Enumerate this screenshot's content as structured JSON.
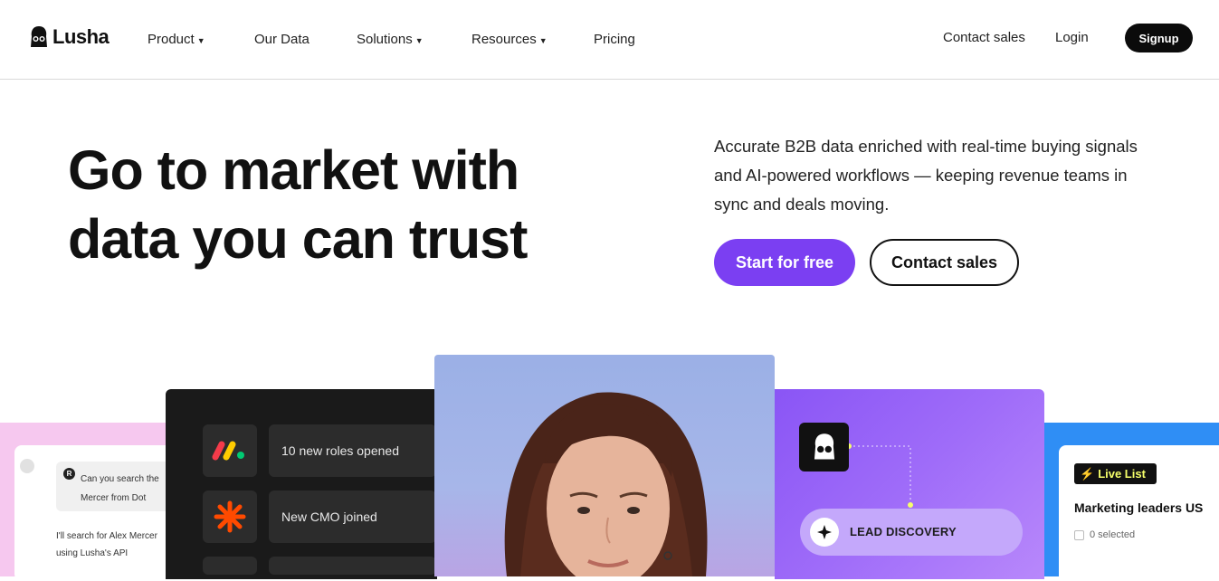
{
  "brand": {
    "name": "Lusha",
    "logo_icon": "lusha-logo-icon"
  },
  "nav": {
    "items": [
      {
        "label": "Product",
        "dropdown": true
      },
      {
        "label": "Our Data",
        "dropdown": false
      },
      {
        "label": "Solutions",
        "dropdown": true
      },
      {
        "label": "Resources",
        "dropdown": true
      },
      {
        "label": "Pricing",
        "dropdown": false
      }
    ],
    "contact_sales": "Contact sales",
    "login": "Login",
    "signup": "Signup"
  },
  "hero": {
    "headline_line1": "Go to market with",
    "headline_line2": "data you can trust",
    "subheading": "Accurate B2B data enriched with real-time buying signals and AI-powered workflows — keeping revenue teams in sync and deals moving.",
    "cta_primary": "Start for free",
    "cta_secondary": "Contact sales"
  },
  "cards": {
    "chat": {
      "avatar_letter": "R",
      "question": "Can you search the Mercer from Dot",
      "answer": "I'll search for Alex Mercer using Lusha's API"
    },
    "signals": [
      {
        "icon": "monday-logo-icon",
        "text": "10 new roles opened"
      },
      {
        "icon": "zapier-asterisk-icon",
        "text": "New CMO joined"
      }
    ],
    "workflow": {
      "label": "LEAD DISCOVERY"
    },
    "live_list": {
      "badge": "Live List",
      "title": "Marketing leaders US",
      "selected": "0 selected"
    }
  },
  "colors": {
    "accent": "#7b3ff2",
    "dark": "#0b0b0b",
    "blue": "#2f8ef5",
    "pink": "#f6c8ef"
  }
}
